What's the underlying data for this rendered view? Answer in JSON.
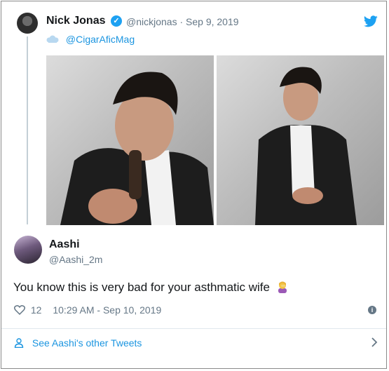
{
  "quoted_tweet": {
    "name": "Nick Jonas",
    "handle": "@nickjonas",
    "separator": "·",
    "date": "Sep 9, 2019",
    "reply_to": "@CigarAficMag"
  },
  "tweet": {
    "name": "Aashi",
    "handle": "@Aashi_2m",
    "text": "You know this is very bad for your asthmatic wife",
    "likes": "12",
    "timestamp": "10:29 AM - Sep 10, 2019"
  },
  "footer": {
    "see_more": "See Aashi's other Tweets"
  },
  "colors": {
    "link": "#1b95e0",
    "secondary_text": "#657786",
    "verified": "#1da1f2"
  },
  "icons": [
    "verified-icon",
    "twitter-bird-icon",
    "reply-thread-icon",
    "heart-icon",
    "info-icon",
    "user-icon",
    "chevron-right-icon"
  ]
}
